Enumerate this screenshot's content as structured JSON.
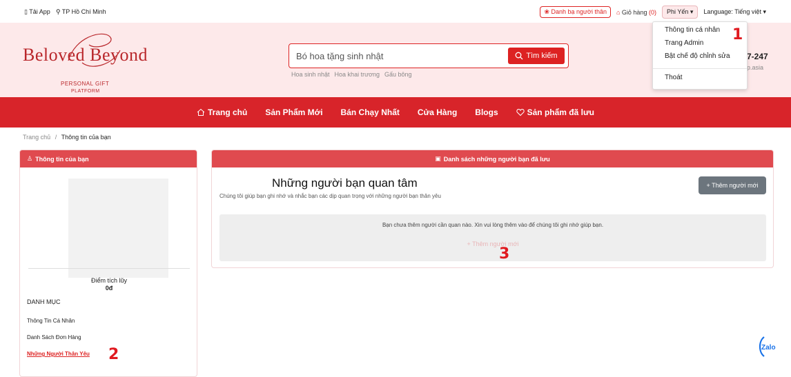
{
  "topbar": {
    "app_link": "Tải App",
    "location": "TP Hồ Chí Minh",
    "contacts": "Danh bạ người thân",
    "cart_label": "Giỏ hàng",
    "cart_count": "(0)",
    "user_name": "Phi Yến",
    "language": "Language: Tiếng việt"
  },
  "logo": {
    "brand": "Beloved Beyond",
    "tagline_1": "PERSONAL GIFT",
    "tagline_2": "PLATFORM"
  },
  "search": {
    "value": "Bó hoa tặng sinh nhật",
    "button": "Tìm kiếm",
    "suggestions": [
      "Hoa sinh nhật",
      "Hoa khai trương",
      "Gấu bông"
    ]
  },
  "hotline": {
    "partial_number": "7-247",
    "partial_domain": "p.asia"
  },
  "nav": {
    "items": [
      "Trang chủ",
      "Sản Phẩm Mới",
      "Bán Chạy Nhất",
      "Cửa Hàng",
      "Blogs",
      "Sản phẩm đã lưu"
    ]
  },
  "breadcrumb": {
    "home": "Trang chủ",
    "separator": "/",
    "current": "Thông tin của bạn"
  },
  "left_panel": {
    "header": "Thông tin của bạn",
    "points_label": "Điểm tích lũy",
    "points_value": "0đ",
    "category_title": "DANH MỤC",
    "menu": [
      "Thông Tin Cá Nhân",
      "Danh Sách Đơn Hàng",
      "Những Người Thân Yêu"
    ]
  },
  "right_panel": {
    "header": "Danh sách những người bạn đã lưu",
    "title": "Những người bạn quan tâm",
    "subtitle": "Chúng tôi giúp bạn ghi nhớ và nhắc bạn các dịp quan trọng với những người bạn thân yêu",
    "add_button": "+ Thêm người mới",
    "empty_message": "Bạn chưa thêm người cần quan nào. Xin vui lòng thêm vào để chúng tôi ghi nhớ giúp bạn.",
    "add_link": "+ Thêm người mới"
  },
  "dropdown": {
    "items": [
      "Thông tin cá nhân",
      "Trang Admin",
      "Bật chế độ chỉnh sửa",
      "Thoát"
    ]
  },
  "annotations": [
    "1",
    "2",
    "3"
  ],
  "zalo_label": "Zalo",
  "colors": {
    "brand_red": "#d8242a",
    "panel_header": "#e04a4f",
    "header_bg": "#fde9ea",
    "button_gray": "#6c757d"
  }
}
